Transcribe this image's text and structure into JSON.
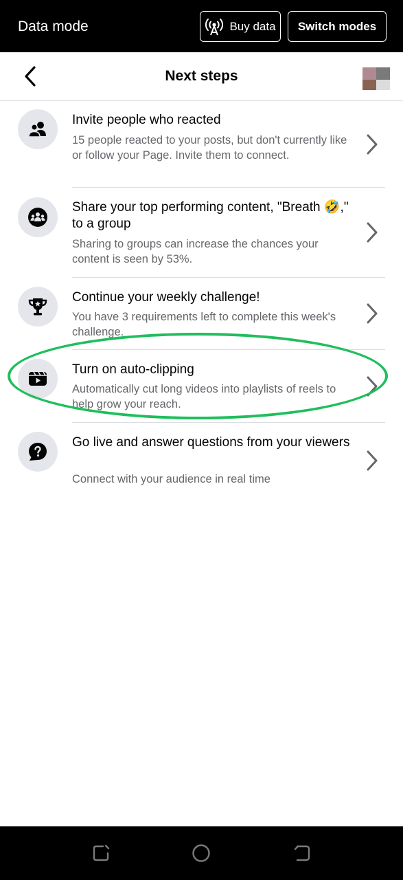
{
  "data_bar": {
    "title": "Data mode",
    "buy_data_label": "Buy data",
    "switch_modes_label": "Switch modes"
  },
  "header": {
    "title": "Next steps"
  },
  "steps": [
    {
      "icon": "people-icon",
      "title": "Invite people who reacted",
      "description": "15 people reacted to your posts, but don't currently like or follow your Page. Invite them to connect."
    },
    {
      "icon": "group-icon",
      "title": "Share your top performing content, \"Breath 🤣,\" to a group",
      "description": "Sharing to groups can increase the chances your content is seen by 53%."
    },
    {
      "icon": "trophy-icon",
      "title": "Continue your weekly challenge!",
      "description": "You have 3 requirements left to complete this week's challenge."
    },
    {
      "icon": "video-clip-icon",
      "title": "Turn on auto-clipping",
      "description": "Automatically cut long videos into playlists of reels to help grow your reach."
    },
    {
      "icon": "question-icon",
      "title": "Go live and answer questions from your viewers",
      "description": "Connect with your audience in real time"
    }
  ],
  "colors": {
    "annotation": "#1fbe5c",
    "icon_bg": "#e4e6eb",
    "secondary_text": "#65676b"
  }
}
